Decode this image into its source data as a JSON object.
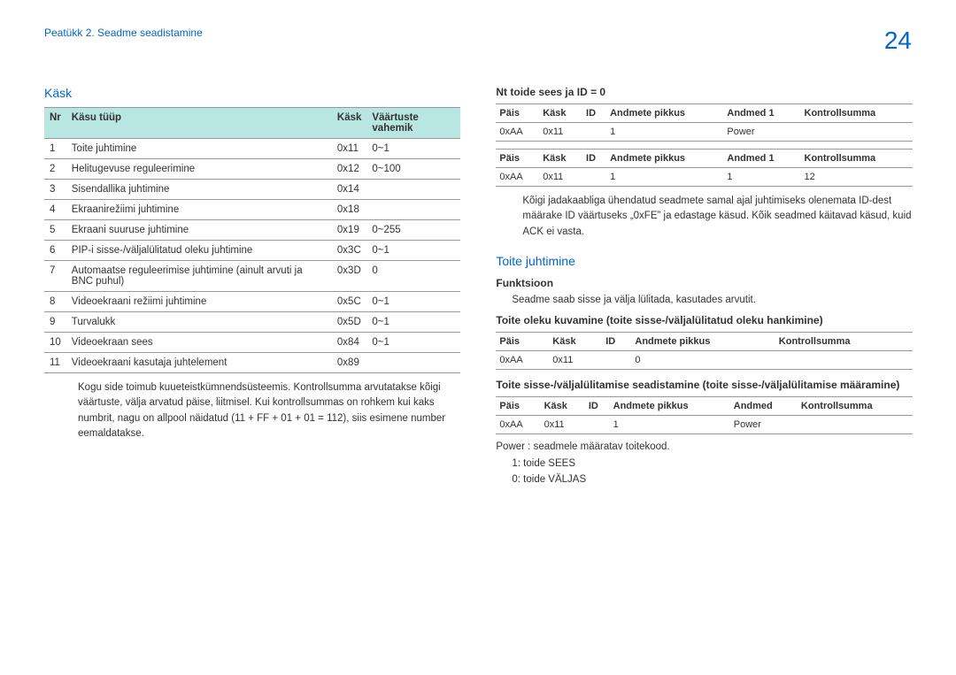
{
  "header": {
    "breadcrumb": "Peatükk 2. Seadme seadistamine",
    "page_number": "24"
  },
  "left": {
    "title": "Käsk",
    "table_headers": {
      "nr": "Nr",
      "type": "Käsu tüüp",
      "cmd": "Käsk",
      "range": "Väärtuste vahemik"
    },
    "rows": [
      {
        "nr": "1",
        "type": "Toite juhtimine",
        "cmd": "0x11",
        "range": "0~1"
      },
      {
        "nr": "2",
        "type": "Helitugevuse reguleerimine",
        "cmd": "0x12",
        "range": "0~100"
      },
      {
        "nr": "3",
        "type": "Sisendallika juhtimine",
        "cmd": "0x14",
        "range": ""
      },
      {
        "nr": "4",
        "type": "Ekraanirežiimi juhtimine",
        "cmd": "0x18",
        "range": ""
      },
      {
        "nr": "5",
        "type": "Ekraani suuruse juhtimine",
        "cmd": "0x19",
        "range": "0~255"
      },
      {
        "nr": "6",
        "type": "PIP-i sisse-/väljalülitatud oleku juhtimine",
        "cmd": "0x3C",
        "range": "0~1"
      },
      {
        "nr": "7",
        "type": "Automaatse reguleerimise juhtimine (ainult arvuti ja BNC puhul)",
        "cmd": "0x3D",
        "range": "0"
      },
      {
        "nr": "8",
        "type": "Videoekraani režiimi juhtimine",
        "cmd": "0x5C",
        "range": "0~1"
      },
      {
        "nr": "9",
        "type": "Turvalukk",
        "cmd": "0x5D",
        "range": "0~1"
      },
      {
        "nr": "10",
        "type": "Videoekraan sees",
        "cmd": "0x84",
        "range": "0~1"
      },
      {
        "nr": "11",
        "type": "Videoekraani kasutaja juhtelement",
        "cmd": "0x89",
        "range": ""
      }
    ],
    "note": "Kogu side toimub kuueteistkümnendsüsteemis. Kontrollsumma arvutatakse kõigi väärtuste, välja arvatud päise, liitmisel. Kui kontrollsummas on rohkem kui kaks numbrit, nagu on allpool näidatud (11 + FF + 01 + 01 = 112), siis esimene number eemaldatakse."
  },
  "right": {
    "ex_title": "Nt toide sees ja ID = 0",
    "hdr": {
      "pais": "Päis",
      "cmd": "Käsk",
      "id": "ID",
      "len": "Andmete pikkus",
      "d1": "Andmed 1",
      "cs": "Kontrollsumma"
    },
    "ex_row1": {
      "pais": "0xAA",
      "cmd": "0x11",
      "id": "",
      "len": "1",
      "d1": "Power",
      "cs": ""
    },
    "ex_row2": {
      "pais": "0xAA",
      "cmd": "0x11",
      "id": "",
      "len": "1",
      "d1": "1",
      "cs": "12"
    },
    "ex_note": "Kõigi jadakaabliga ühendatud seadmete samal ajal juhtimiseks olenemata ID-dest määrake ID väärtuseks „0xFE” ja edastage käsud. Kõik seadmed käitavad käsud, kuid ACK ei vasta.",
    "power_title": "Toite juhtimine",
    "func_label": "Funktsioon",
    "func_text": "Seadme saab sisse ja välja lülitada, kasutades arvutit.",
    "view_title": "Toite oleku kuvamine (toite sisse-/väljalülitatud oleku hankimine)",
    "view_row": {
      "pais": "0xAA",
      "cmd": "0x11",
      "id": "",
      "len": "0",
      "cs": ""
    },
    "set_title": "Toite sisse-/väljalülitamise seadistamine (toite sisse-/väljalülitamise määramine)",
    "set_hdr": {
      "pais": "Päis",
      "cmd": "Käsk",
      "id": "ID",
      "len": "Andmete pikkus",
      "d1": "Andmed",
      "cs": "Kontrollsumma"
    },
    "set_row": {
      "pais": "0xAA",
      "cmd": "0x11",
      "id": "",
      "len": "1",
      "d1": "Power",
      "cs": ""
    },
    "power_note": "Power : seadmele määratav toitekood.",
    "power_on": "1: toide SEES",
    "power_off": "0: toide VÄLJAS"
  }
}
